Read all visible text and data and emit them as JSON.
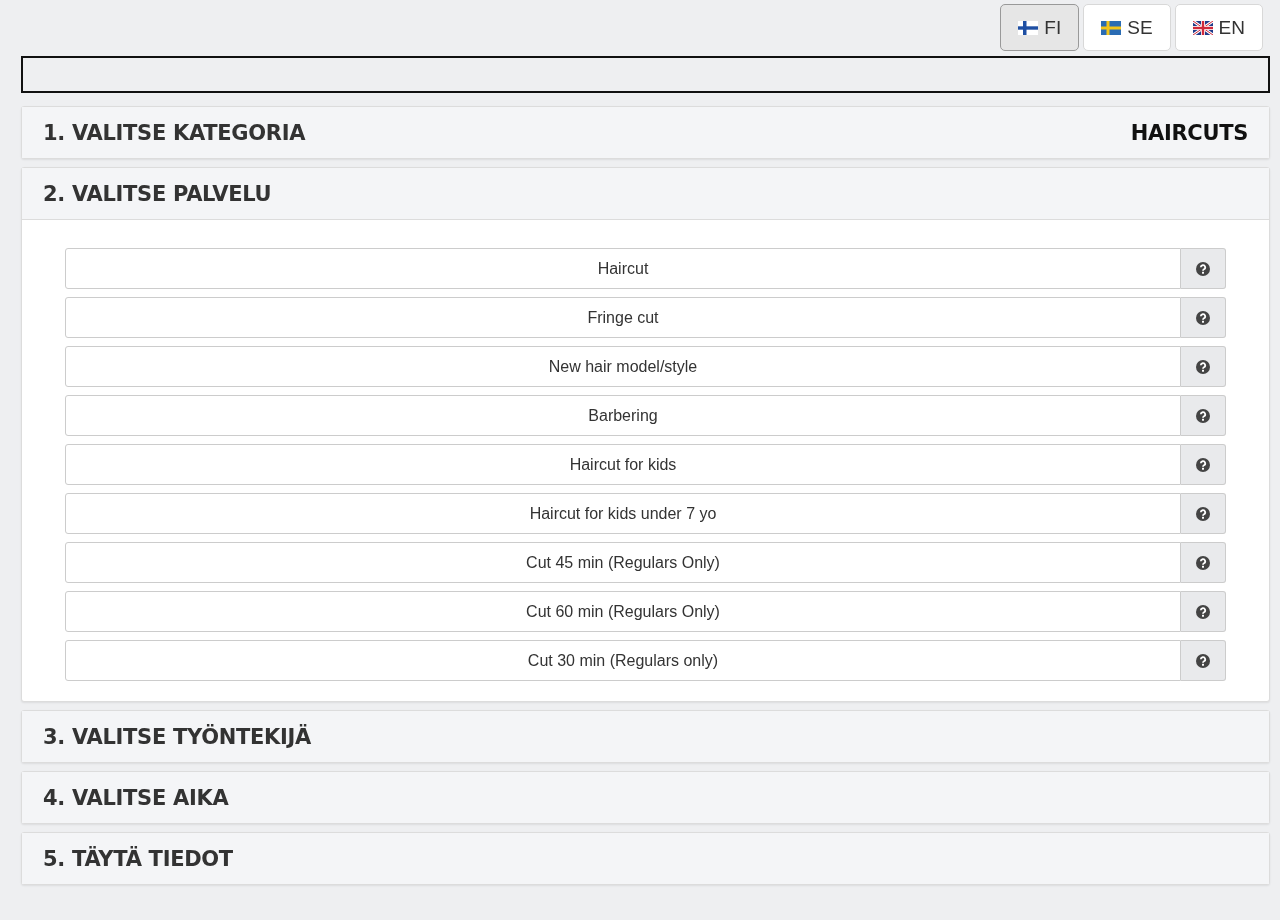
{
  "languages": [
    {
      "kind": "finland",
      "label": "FI",
      "selected": true
    },
    {
      "kind": "sweden",
      "label": "SE",
      "selected": false
    },
    {
      "kind": "britain",
      "label": "EN",
      "selected": false
    }
  ],
  "sections": [
    {
      "title": "1. VALITSE KATEGORIA",
      "value": "HAIRCUTS",
      "expanded": false
    },
    {
      "title": "2. VALITSE PALVELU",
      "expanded": true,
      "services": [
        "Haircut",
        "Fringe cut",
        "New hair model/style",
        "Barbering",
        "Haircut for kids",
        "Haircut for kids under 7 yo",
        "Cut 45 min (Regulars Only)",
        "Cut 60 min (Regulars Only)",
        "Cut 30 min (Regulars only)"
      ]
    },
    {
      "title": "3. VALITSE TYÖNTEKIJÄ",
      "expanded": false
    },
    {
      "title": "4. VALITSE AIKA",
      "expanded": false
    },
    {
      "title": "5. TÄYTÄ TIEDOT",
      "expanded": false
    }
  ]
}
